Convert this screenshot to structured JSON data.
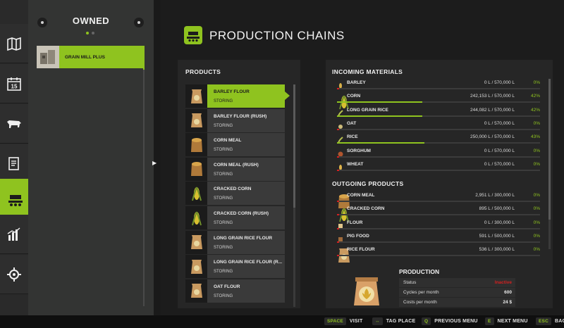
{
  "owned_panel": {
    "title": "OWNED",
    "items": [
      {
        "label": "GRAIN MILL PLUS"
      }
    ]
  },
  "sidebar": {
    "items": [
      {
        "name": "map-icon"
      },
      {
        "name": "calendar-icon",
        "day": "15"
      },
      {
        "name": "animals-icon"
      },
      {
        "name": "contracts-icon"
      },
      {
        "name": "production-icon",
        "active": true
      },
      {
        "name": "statistics-icon"
      },
      {
        "name": "settings-icon"
      }
    ]
  },
  "main": {
    "title": "PRODUCTION CHAINS"
  },
  "products": {
    "header": "PRODUCTS",
    "items": [
      {
        "name": "BARLEY FLOUR",
        "state": "STORING",
        "selected": true,
        "icon": "flour-sack-icon"
      },
      {
        "name": "BARLEY FLOUR (RUSH)",
        "state": "STORING",
        "icon": "flour-sack-icon"
      },
      {
        "name": "CORN MEAL",
        "state": "STORING",
        "icon": "meal-sack-icon"
      },
      {
        "name": "CORN MEAL (RUSH)",
        "state": "STORING",
        "icon": "meal-sack-icon"
      },
      {
        "name": "CRACKED CORN",
        "state": "STORING",
        "icon": "corn-icon"
      },
      {
        "name": "CRACKED CORN (RUSH)",
        "state": "STORING",
        "icon": "corn-icon"
      },
      {
        "name": "LONG GRAIN RICE FLOUR",
        "state": "STORING",
        "icon": "flour-sack-icon"
      },
      {
        "name": "LONG GRAIN RICE FLOUR (R...",
        "state": "STORING",
        "icon": "flour-sack-icon"
      },
      {
        "name": "OAT FLOUR",
        "state": "STORING",
        "icon": "flour-sack-icon"
      }
    ]
  },
  "incoming": {
    "header": "INCOMING MATERIALS",
    "items": [
      {
        "name": "BARLEY",
        "amount": "0 L / 570,000 L",
        "pct": "0%",
        "fill": 0,
        "icon": "barley-icon"
      },
      {
        "name": "CORN",
        "amount": "242,153 L / 570,000 L",
        "pct": "42%",
        "fill": 0.42,
        "icon": "corn-icon"
      },
      {
        "name": "LONG GRAIN RICE",
        "amount": "244,082 L / 570,000 L",
        "pct": "42%",
        "fill": 0.42,
        "icon": "rice-icon"
      },
      {
        "name": "OAT",
        "amount": "0 L / 570,000 L",
        "pct": "0%",
        "fill": 0,
        "icon": "oat-icon"
      },
      {
        "name": "RICE",
        "amount": "250,000 L / 570,000 L",
        "pct": "43%",
        "fill": 0.43,
        "icon": "rice-icon"
      },
      {
        "name": "SORGHUM",
        "amount": "0 L / 570,000 L",
        "pct": "0%",
        "fill": 0,
        "icon": "sorghum-icon"
      },
      {
        "name": "WHEAT",
        "amount": "0 L / 570,000 L",
        "pct": "0%",
        "fill": 0,
        "icon": "wheat-icon"
      }
    ]
  },
  "outgoing": {
    "header": "OUTGOING PRODUCTS",
    "items": [
      {
        "name": "CORN MEAL",
        "amount": "2,951 L / 300,000 L",
        "pct": "0%",
        "fill": 0.01,
        "icon": "meal-sack-icon"
      },
      {
        "name": "CRACKED CORN",
        "amount": "895 L / 500,000 L",
        "pct": "0%",
        "fill": 0,
        "icon": "corn-icon"
      },
      {
        "name": "FLOUR",
        "amount": "0 L / 300,000 L",
        "pct": "0%",
        "fill": 0,
        "icon": "flour-icon"
      },
      {
        "name": "PIG FOOD",
        "amount": "591 L / 500,000 L",
        "pct": "0%",
        "fill": 0,
        "icon": "pig-food-icon"
      },
      {
        "name": "RICE FLOUR",
        "amount": "536 L / 300,000 L",
        "pct": "0%",
        "fill": 0,
        "icon": "flour-sack-icon"
      }
    ]
  },
  "production": {
    "header": "PRODUCTION",
    "status_label": "Status",
    "status_value": "Inactive",
    "cycles_label": "Cycles per month",
    "cycles_value": "600",
    "costs_label": "Costs per month",
    "costs_value": "24 $"
  },
  "bottom_bar": [
    {
      "key": "SPACE",
      "label": "VISIT"
    },
    {
      "key": "↔",
      "label": "TAG PLACE"
    },
    {
      "key": "Q",
      "label": "PREVIOUS MENU"
    },
    {
      "key": "E",
      "label": "NEXT MENU"
    },
    {
      "key": "ESC",
      "label": "BAC"
    }
  ],
  "colors": {
    "accent": "#8fc31f",
    "warning": "#d42020",
    "panel": "#262626"
  }
}
